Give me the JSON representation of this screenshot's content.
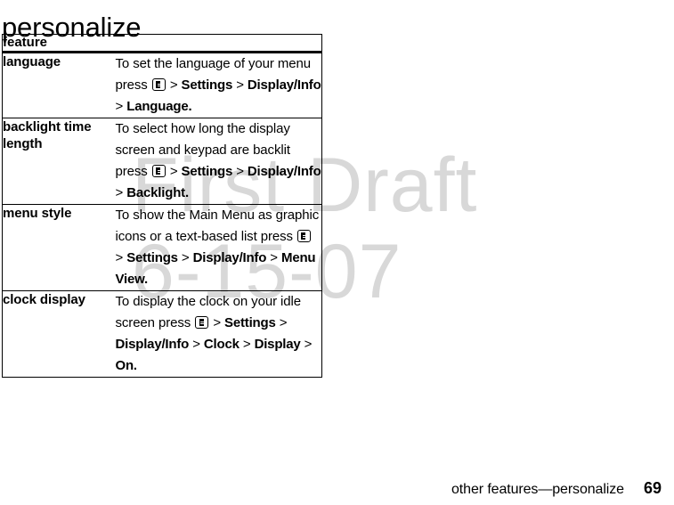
{
  "document": {
    "title": "personalize",
    "watermark": {
      "line1": "First Draft",
      "line2": "6-15-07",
      "color": "#d8d8d8"
    }
  },
  "table": {
    "header": {
      "feature_label": "feature",
      "description_label": ""
    },
    "rows": [
      {
        "feature": "language",
        "description_plain": "To set the language of your menu press  > Settings > Display/Info > Language.",
        "runs": [
          {
            "type": "text",
            "value": "To set the language of your menu press "
          },
          {
            "type": "icon",
            "value": "menu-key-icon"
          },
          {
            "type": "sep",
            "value": " > "
          },
          {
            "type": "path",
            "value": "Settings"
          },
          {
            "type": "sep",
            "value": " > "
          },
          {
            "type": "path",
            "value": "Display/Info"
          },
          {
            "type": "sep",
            "value": " > "
          },
          {
            "type": "path",
            "value": "Language."
          }
        ]
      },
      {
        "feature": "backlight time length",
        "description_plain": "To select how long the display screen and keypad are backlit press  > Settings > Display/Info > Backlight.",
        "runs": [
          {
            "type": "text",
            "value": "To select how long the display screen and keypad are backlit press "
          },
          {
            "type": "icon",
            "value": "menu-key-icon"
          },
          {
            "type": "sep",
            "value": " > "
          },
          {
            "type": "path",
            "value": "Settings"
          },
          {
            "type": "sep",
            "value": " > "
          },
          {
            "type": "path",
            "value": "Display/Info"
          },
          {
            "type": "sep",
            "value": " > "
          },
          {
            "type": "path",
            "value": "Backlight."
          }
        ]
      },
      {
        "feature": "menu style",
        "description_plain": "To show the Main Menu as graphic icons or a text-based list press  > Settings > Display/Info > Menu View.",
        "runs": [
          {
            "type": "text",
            "value": "To show the Main Menu as graphic icons or a text-based list press "
          },
          {
            "type": "icon",
            "value": "menu-key-icon"
          },
          {
            "type": "sep",
            "value": " > "
          },
          {
            "type": "path",
            "value": "Settings"
          },
          {
            "type": "sep",
            "value": " > "
          },
          {
            "type": "path",
            "value": "Display/Info"
          },
          {
            "type": "sep",
            "value": " > "
          },
          {
            "type": "path",
            "value": "Menu View."
          }
        ]
      },
      {
        "feature": "clock display",
        "description_plain": "To display the clock on your idle screen press  > Settings > Display/Info > Clock > Display > On.",
        "runs": [
          {
            "type": "text",
            "value": "To display the clock on your idle screen press "
          },
          {
            "type": "icon",
            "value": "menu-key-icon"
          },
          {
            "type": "sep",
            "value": " > "
          },
          {
            "type": "path",
            "value": "Settings"
          },
          {
            "type": "sep",
            "value": " > "
          },
          {
            "type": "path",
            "value": "Display/Info"
          },
          {
            "type": "sep",
            "value": " > "
          },
          {
            "type": "path",
            "value": "Clock"
          },
          {
            "type": "sep",
            "value": " > "
          },
          {
            "type": "path",
            "value": "Display"
          },
          {
            "type": "sep",
            "value": " > "
          },
          {
            "type": "path",
            "value": "On."
          }
        ]
      }
    ]
  },
  "footer": {
    "text": "other features—personalize",
    "page_number": "69"
  }
}
